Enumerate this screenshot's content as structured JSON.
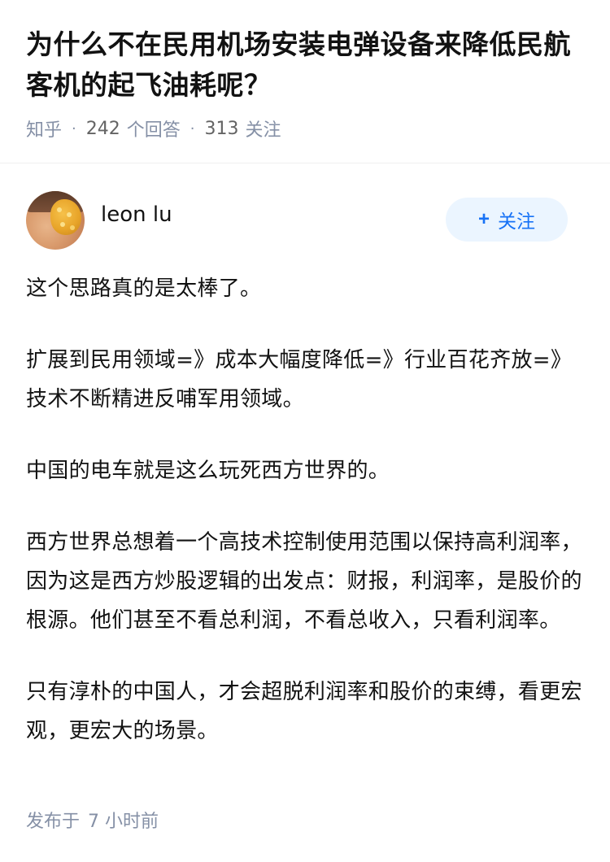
{
  "question": {
    "title": "为什么不在民用机场安装电弹设备来降低民航客机的起飞油耗呢？",
    "source": "知乎",
    "answers_count": "242",
    "answers_label": "个回答",
    "followers_count": "313",
    "followers_label": "关注"
  },
  "answer": {
    "author_name": "leon lu",
    "follow_button": {
      "icon": "+",
      "label": "关注"
    },
    "paragraphs": [
      "这个思路真的是太棒了。",
      "扩展到民用领域=》成本大幅度降低=》行业百花齐放=》技术不断精进反哺军用领域。",
      "中国的电车就是这么玩死西方世界的。",
      "西方世界总想着一个高技术控制使用范围以保持高利润率，因为这是西方炒股逻辑的出发点：财报，利润率，是股价的根源。他们甚至不看总利润，不看总收入，只看利润率。",
      "只有淳朴的中国人，才会超脱利润率和股价的束缚，看更宏观，更宏大的场景。"
    ],
    "publish_label": "发布于",
    "publish_time": "7 小时前"
  },
  "colors": {
    "meta_gray": "#8590a6",
    "follow_blue": "#1772f6",
    "follow_bg": "#ebf5ff"
  }
}
